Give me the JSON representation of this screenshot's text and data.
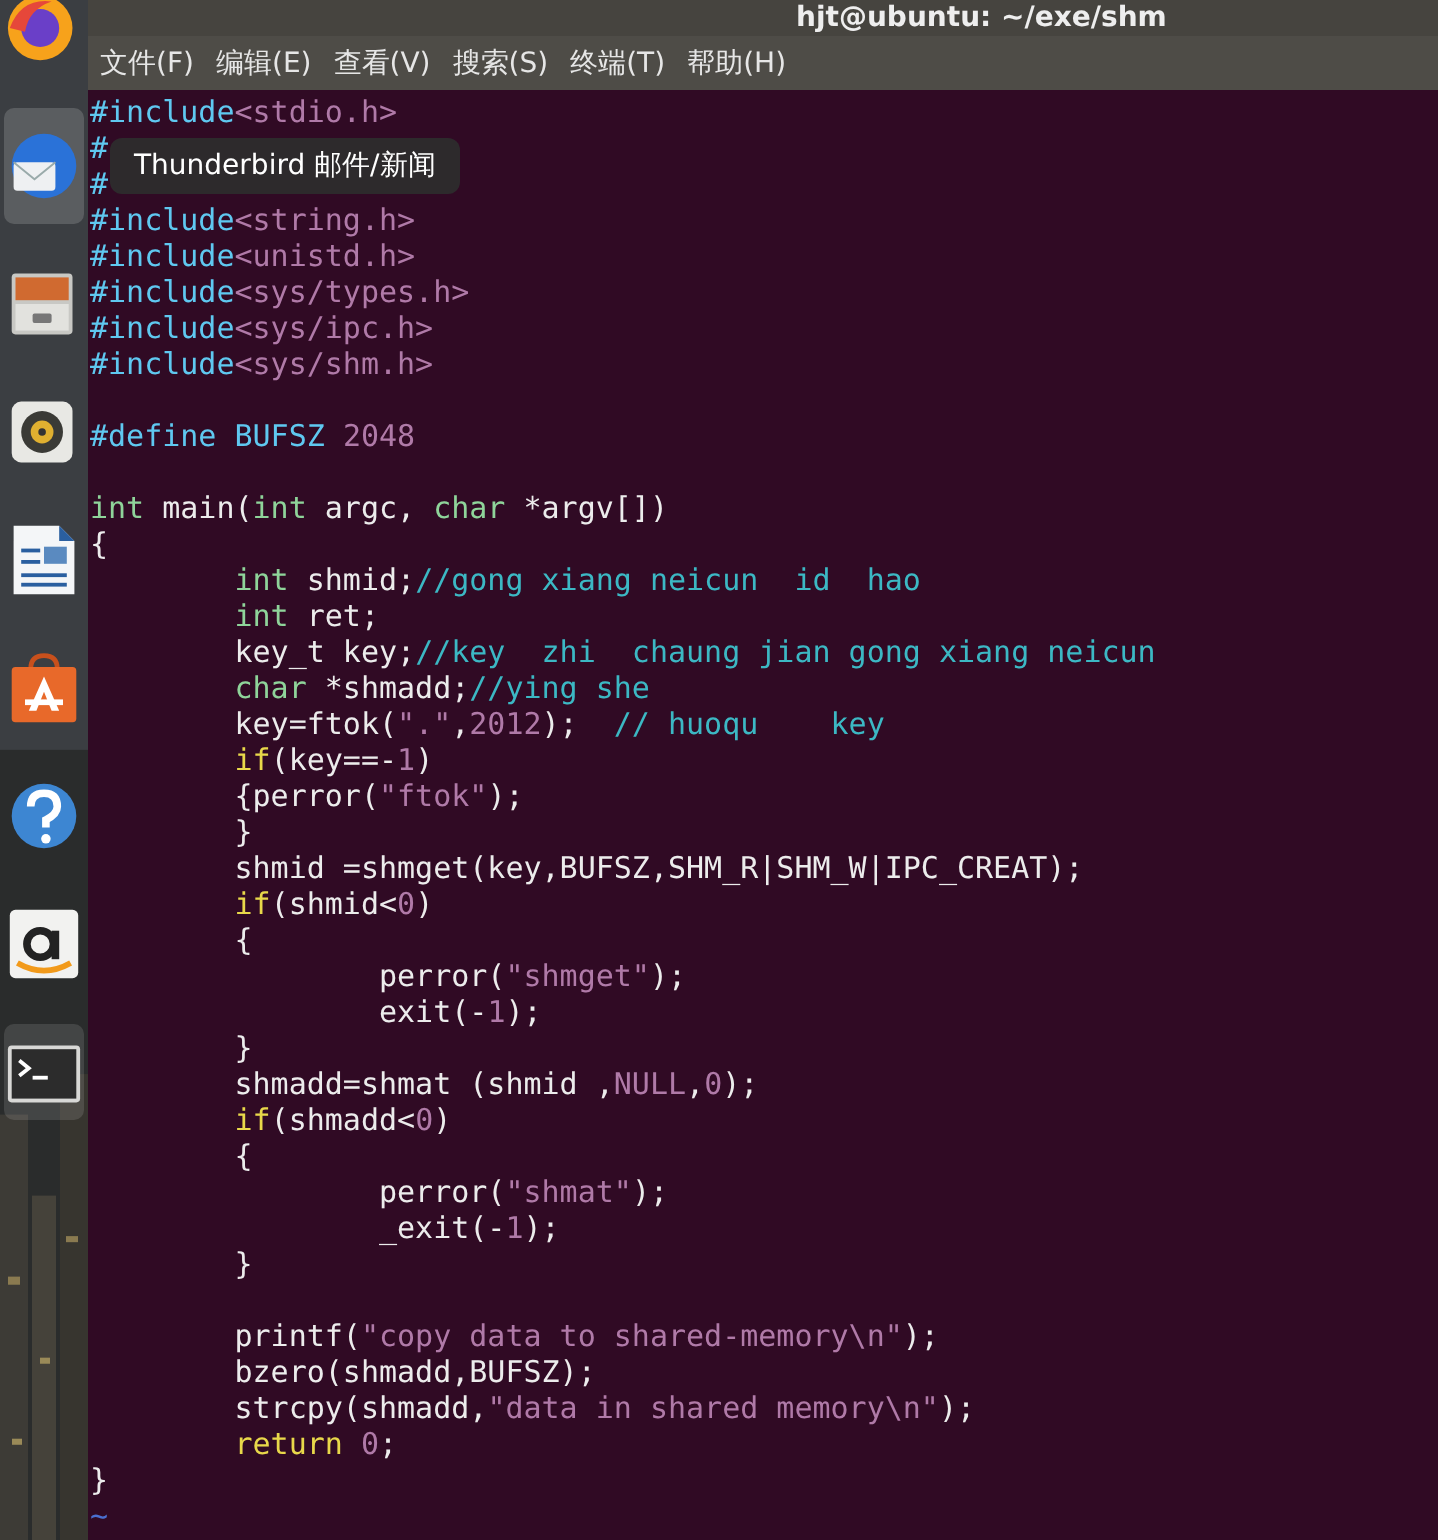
{
  "dock": {
    "items": [
      {
        "kind": "firefox",
        "hovered": false,
        "active": false
      },
      {
        "kind": "mail",
        "hovered": true,
        "active": false
      },
      {
        "kind": "files",
        "hovered": false,
        "active": false
      },
      {
        "kind": "music",
        "hovered": false,
        "active": false
      },
      {
        "kind": "writer",
        "hovered": false,
        "active": false
      },
      {
        "kind": "store",
        "hovered": false,
        "active": false
      },
      {
        "kind": "help",
        "hovered": false,
        "active": false
      },
      {
        "kind": "amazon",
        "hovered": false,
        "active": false
      },
      {
        "kind": "terminal",
        "hovered": false,
        "active": true
      }
    ]
  },
  "tooltip": {
    "text": "Thunderbird 邮件/新闻"
  },
  "window": {
    "title": "hjt@ubuntu: ~/exe/shm"
  },
  "menu": [
    "文件(F)",
    "编辑(E)",
    "查看(V)",
    "搜索(S)",
    "终端(T)",
    "帮助(H)"
  ],
  "editor": {
    "lines": [
      {
        "kind": "code",
        "segments": [
          {
            "t": "#include",
            "kind": "pp"
          },
          {
            "t": "<stdio.h>",
            "kind": "str"
          }
        ]
      },
      {
        "kind": "code",
        "segments": [
          {
            "t": "#",
            "kind": "pp"
          }
        ]
      },
      {
        "kind": "code",
        "segments": [
          {
            "t": "#",
            "kind": "pp"
          }
        ]
      },
      {
        "kind": "code",
        "segments": [
          {
            "t": "#include",
            "kind": "pp"
          },
          {
            "t": "<string.h>",
            "kind": "str"
          }
        ]
      },
      {
        "kind": "code",
        "segments": [
          {
            "t": "#include",
            "kind": "pp"
          },
          {
            "t": "<unistd.h>",
            "kind": "str"
          }
        ]
      },
      {
        "kind": "code",
        "segments": [
          {
            "t": "#include",
            "kind": "pp"
          },
          {
            "t": "<sys/types.h>",
            "kind": "str"
          }
        ]
      },
      {
        "kind": "code",
        "segments": [
          {
            "t": "#include",
            "kind": "pp"
          },
          {
            "t": "<sys/ipc.h>",
            "kind": "str"
          }
        ]
      },
      {
        "kind": "code",
        "segments": [
          {
            "t": "#include",
            "kind": "pp"
          },
          {
            "t": "<sys/shm.h>",
            "kind": "str"
          }
        ]
      },
      {
        "kind": "blank"
      },
      {
        "kind": "code",
        "segments": [
          {
            "t": "#define BUFSZ ",
            "kind": "pp"
          },
          {
            "t": "2048",
            "kind": "num"
          }
        ]
      },
      {
        "kind": "blank"
      },
      {
        "kind": "code",
        "segments": [
          {
            "t": "int",
            "kind": "type"
          },
          {
            "t": " main(",
            "kind": "plain"
          },
          {
            "t": "int",
            "kind": "type"
          },
          {
            "t": " argc, ",
            "kind": "plain"
          },
          {
            "t": "char",
            "kind": "type"
          },
          {
            "t": " *argv[])",
            "kind": "plain"
          }
        ]
      },
      {
        "kind": "code",
        "segments": [
          {
            "t": "{",
            "kind": "plain"
          }
        ]
      },
      {
        "kind": "code",
        "segments": [
          {
            "t": "\tint",
            "kind": "type"
          },
          {
            "t": " shmid;",
            "kind": "plain"
          },
          {
            "t": "//gong xiang neicun  id  hao",
            "kind": "cmt"
          }
        ]
      },
      {
        "kind": "code",
        "segments": [
          {
            "t": "\tint",
            "kind": "type"
          },
          {
            "t": " ret;",
            "kind": "plain"
          }
        ]
      },
      {
        "kind": "code",
        "segments": [
          {
            "t": "\tkey_t key;",
            "kind": "plain"
          },
          {
            "t": "//key  zhi  chaung jian gong xiang neicun",
            "kind": "cmt"
          }
        ]
      },
      {
        "kind": "code",
        "segments": [
          {
            "t": "\tchar",
            "kind": "type"
          },
          {
            "t": " *shmadd;",
            "kind": "plain"
          },
          {
            "t": "//ying she",
            "kind": "cmt"
          }
        ]
      },
      {
        "kind": "code",
        "segments": [
          {
            "t": "\tkey=ftok(",
            "kind": "plain"
          },
          {
            "t": "\".\"",
            "kind": "str"
          },
          {
            "t": ",",
            "kind": "plain"
          },
          {
            "t": "2012",
            "kind": "num"
          },
          {
            "t": ");  ",
            "kind": "plain"
          },
          {
            "t": "// huoqu    key",
            "kind": "cmt"
          }
        ]
      },
      {
        "kind": "code",
        "segments": [
          {
            "t": "\tif",
            "kind": "kw"
          },
          {
            "t": "(key==-",
            "kind": "plain"
          },
          {
            "t": "1",
            "kind": "num"
          },
          {
            "t": ")",
            "kind": "plain"
          }
        ]
      },
      {
        "kind": "code",
        "segments": [
          {
            "t": "\t{perror(",
            "kind": "plain"
          },
          {
            "t": "\"ftok\"",
            "kind": "str"
          },
          {
            "t": ");",
            "kind": "plain"
          }
        ]
      },
      {
        "kind": "code",
        "segments": [
          {
            "t": "\t}",
            "kind": "plain"
          }
        ]
      },
      {
        "kind": "code",
        "segments": [
          {
            "t": "\tshmid =shmget(key,BUFSZ,SHM_R|SHM_W|IPC_CREAT);",
            "kind": "plain"
          }
        ]
      },
      {
        "kind": "code",
        "segments": [
          {
            "t": "\tif",
            "kind": "kw"
          },
          {
            "t": "(shmid<",
            "kind": "plain"
          },
          {
            "t": "0",
            "kind": "num"
          },
          {
            "t": ")",
            "kind": "plain"
          }
        ]
      },
      {
        "kind": "code",
        "segments": [
          {
            "t": "\t{",
            "kind": "plain"
          }
        ]
      },
      {
        "kind": "code",
        "segments": [
          {
            "t": "\t\tperror(",
            "kind": "plain"
          },
          {
            "t": "\"shmget\"",
            "kind": "str"
          },
          {
            "t": ");",
            "kind": "plain"
          }
        ]
      },
      {
        "kind": "code",
        "segments": [
          {
            "t": "\t\texit(-",
            "kind": "plain"
          },
          {
            "t": "1",
            "kind": "num"
          },
          {
            "t": ");",
            "kind": "plain"
          }
        ]
      },
      {
        "kind": "code",
        "segments": [
          {
            "t": "\t}",
            "kind": "plain"
          }
        ]
      },
      {
        "kind": "code",
        "segments": [
          {
            "t": "\tshmadd=shmat (shmid ,",
            "kind": "plain"
          },
          {
            "t": "NULL",
            "kind": "num"
          },
          {
            "t": ",",
            "kind": "plain"
          },
          {
            "t": "0",
            "kind": "num"
          },
          {
            "t": ");",
            "kind": "plain"
          }
        ]
      },
      {
        "kind": "code",
        "segments": [
          {
            "t": "\tif",
            "kind": "kw"
          },
          {
            "t": "(shmadd<",
            "kind": "plain"
          },
          {
            "t": "0",
            "kind": "num"
          },
          {
            "t": ")",
            "kind": "plain"
          }
        ]
      },
      {
        "kind": "code",
        "segments": [
          {
            "t": "\t{",
            "kind": "plain"
          }
        ]
      },
      {
        "kind": "code",
        "segments": [
          {
            "t": "\t\tperror(",
            "kind": "plain"
          },
          {
            "t": "\"shmat\"",
            "kind": "str"
          },
          {
            "t": ");",
            "kind": "plain"
          }
        ]
      },
      {
        "kind": "code",
        "segments": [
          {
            "t": "\t\t_exit(-",
            "kind": "plain"
          },
          {
            "t": "1",
            "kind": "num"
          },
          {
            "t": ");",
            "kind": "plain"
          }
        ]
      },
      {
        "kind": "code",
        "segments": [
          {
            "t": "\t}",
            "kind": "plain"
          }
        ]
      },
      {
        "kind": "blank"
      },
      {
        "kind": "code",
        "segments": [
          {
            "t": "\tprintf(",
            "kind": "plain"
          },
          {
            "t": "\"copy data to shared-memory\\n\"",
            "kind": "str"
          },
          {
            "t": ");",
            "kind": "plain"
          }
        ]
      },
      {
        "kind": "code",
        "segments": [
          {
            "t": "\tbzero(shmadd,BUFSZ);",
            "kind": "plain"
          }
        ]
      },
      {
        "kind": "code",
        "segments": [
          {
            "t": "\tstrcpy(shmadd,",
            "kind": "plain"
          },
          {
            "t": "\"data in shared memory\\n\"",
            "kind": "str"
          },
          {
            "t": ");",
            "kind": "plain"
          }
        ]
      },
      {
        "kind": "code",
        "segments": [
          {
            "t": "\treturn",
            "kind": "kw"
          },
          {
            "t": " 0",
            "kind": "num"
          },
          {
            "t": ";",
            "kind": "plain"
          }
        ]
      },
      {
        "kind": "code",
        "segments": [
          {
            "t": "}",
            "kind": "plain"
          }
        ]
      },
      {
        "kind": "filler",
        "text": "~"
      }
    ]
  }
}
